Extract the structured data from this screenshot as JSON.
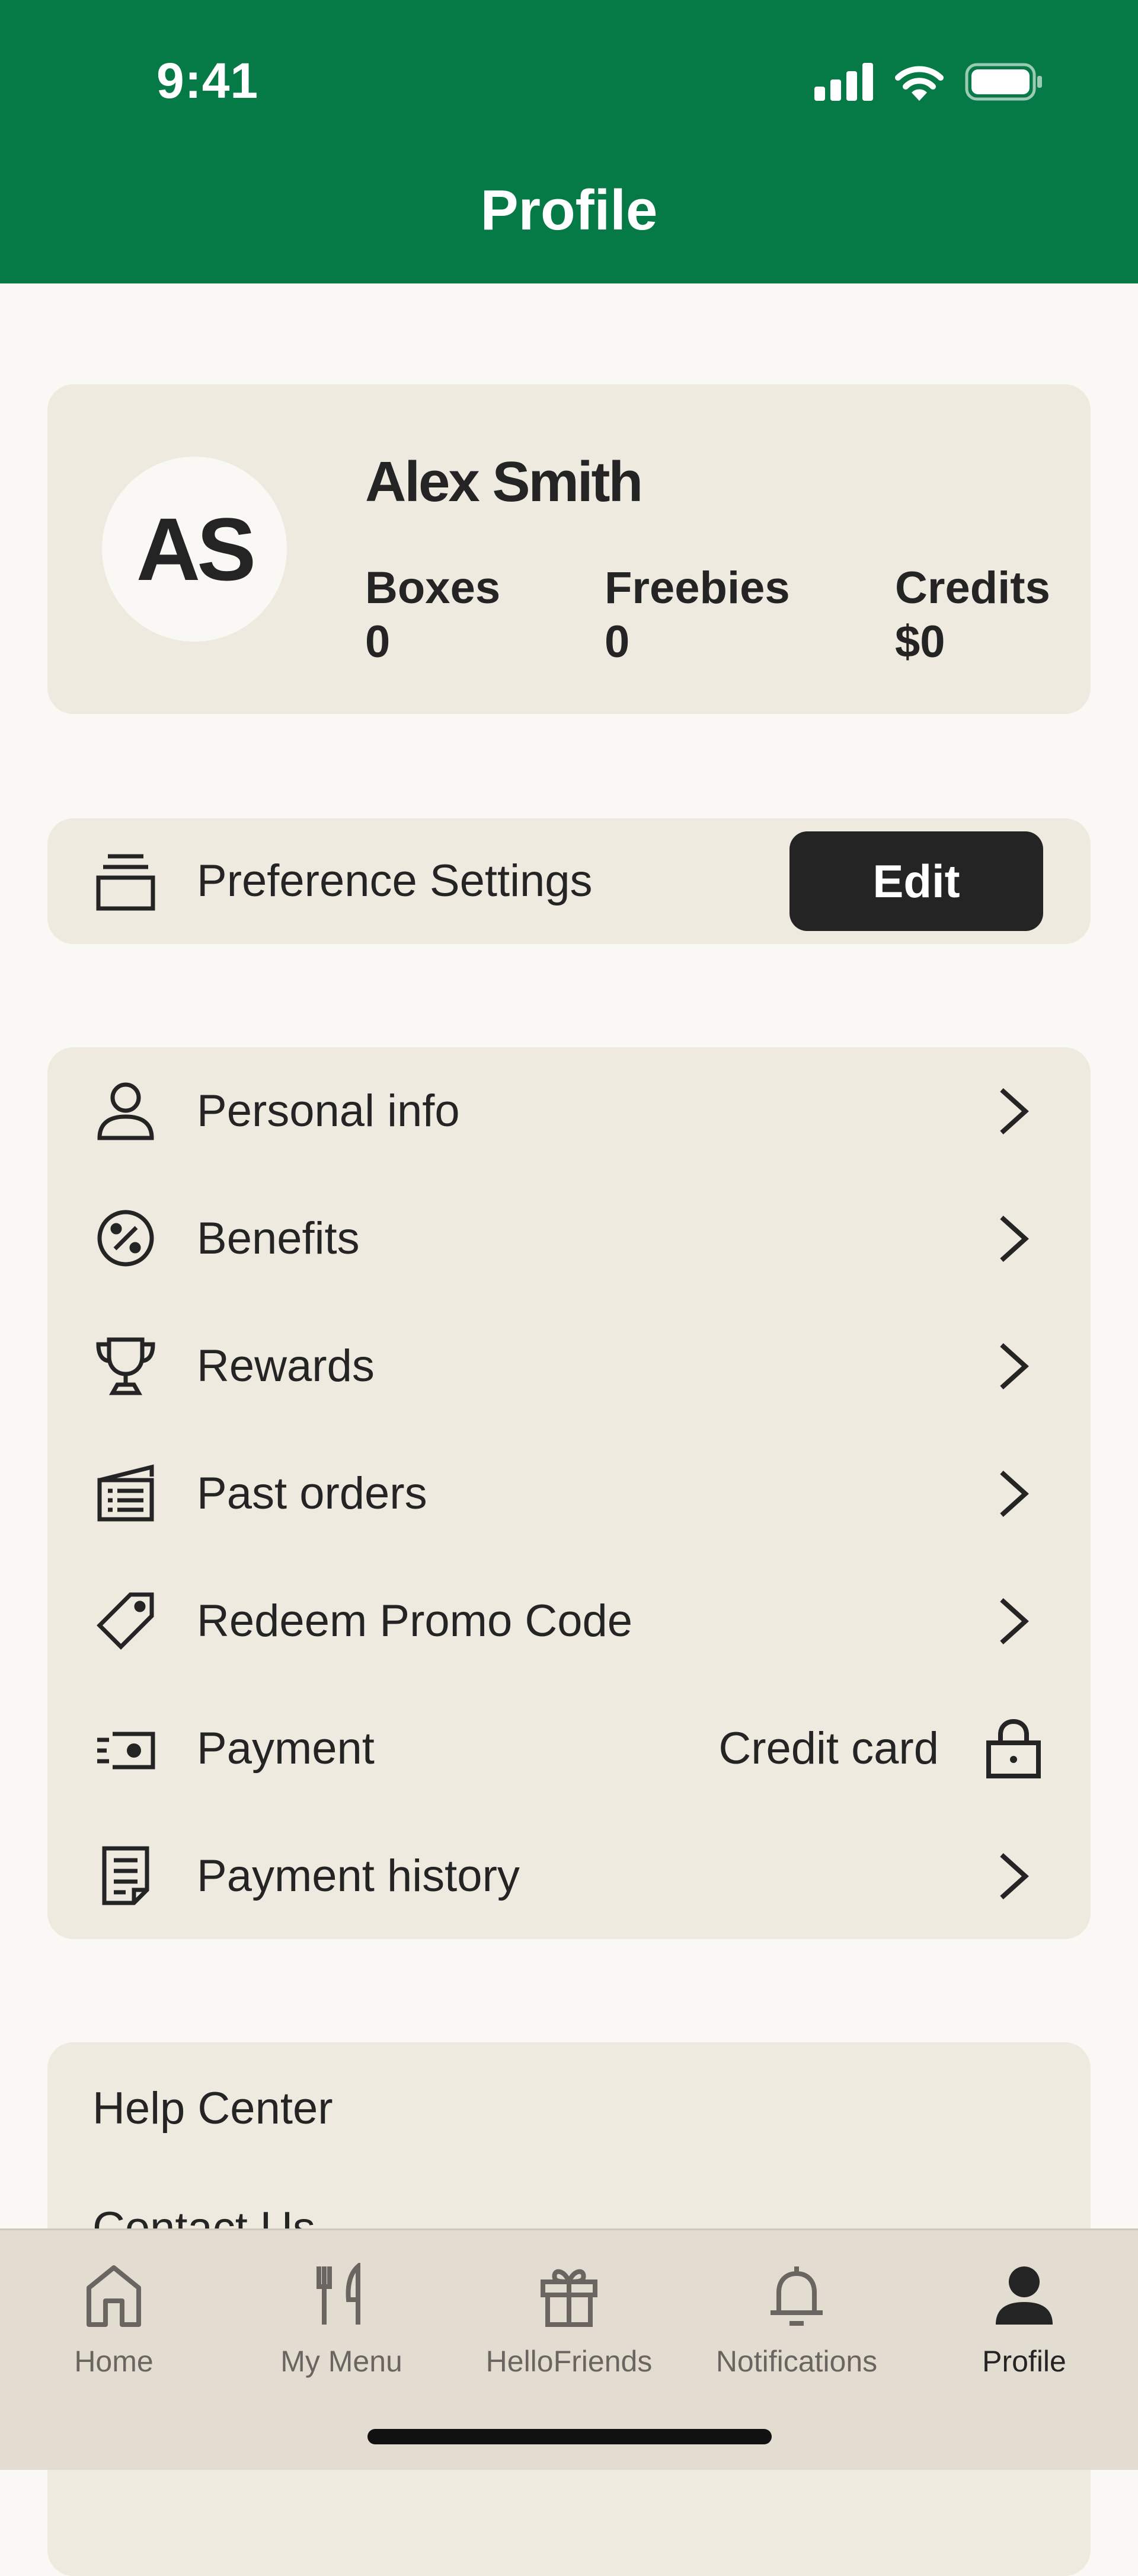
{
  "status_bar": {
    "time": "9:41"
  },
  "header": {
    "title": "Profile"
  },
  "profile": {
    "initials": "AS",
    "name": "Alex Smith",
    "stats": [
      {
        "label": "Boxes",
        "value": "0"
      },
      {
        "label": "Freebies",
        "value": "0"
      },
      {
        "label": "Credits",
        "value": "$0"
      }
    ]
  },
  "preferences": {
    "label": "Preference Settings",
    "button": "Edit"
  },
  "menu": [
    {
      "label": "Personal info",
      "icon": "person-icon"
    },
    {
      "label": "Benefits",
      "icon": "discount-icon"
    },
    {
      "label": "Rewards",
      "icon": "trophy-icon"
    },
    {
      "label": "Past orders",
      "icon": "box-icon"
    },
    {
      "label": "Redeem Promo Code",
      "icon": "tag-icon"
    },
    {
      "label": "Payment",
      "icon": "cash-icon",
      "value": "Credit card"
    },
    {
      "label": "Payment history",
      "icon": "receipt-icon"
    }
  ],
  "help": [
    "Help Center",
    "Contact Us"
  ],
  "tabs": [
    {
      "label": "Home",
      "icon": "home-icon"
    },
    {
      "label": "My Menu",
      "icon": "cutlery-icon"
    },
    {
      "label": "HelloFriends",
      "icon": "gift-icon"
    },
    {
      "label": "Notifications",
      "icon": "bell-icon"
    },
    {
      "label": "Profile",
      "icon": "profile-icon",
      "active": true
    }
  ],
  "colors": {
    "brand_green": "#067A46",
    "card": "#EFEAE0",
    "background": "#F9F8F4",
    "dark": "#242424"
  }
}
